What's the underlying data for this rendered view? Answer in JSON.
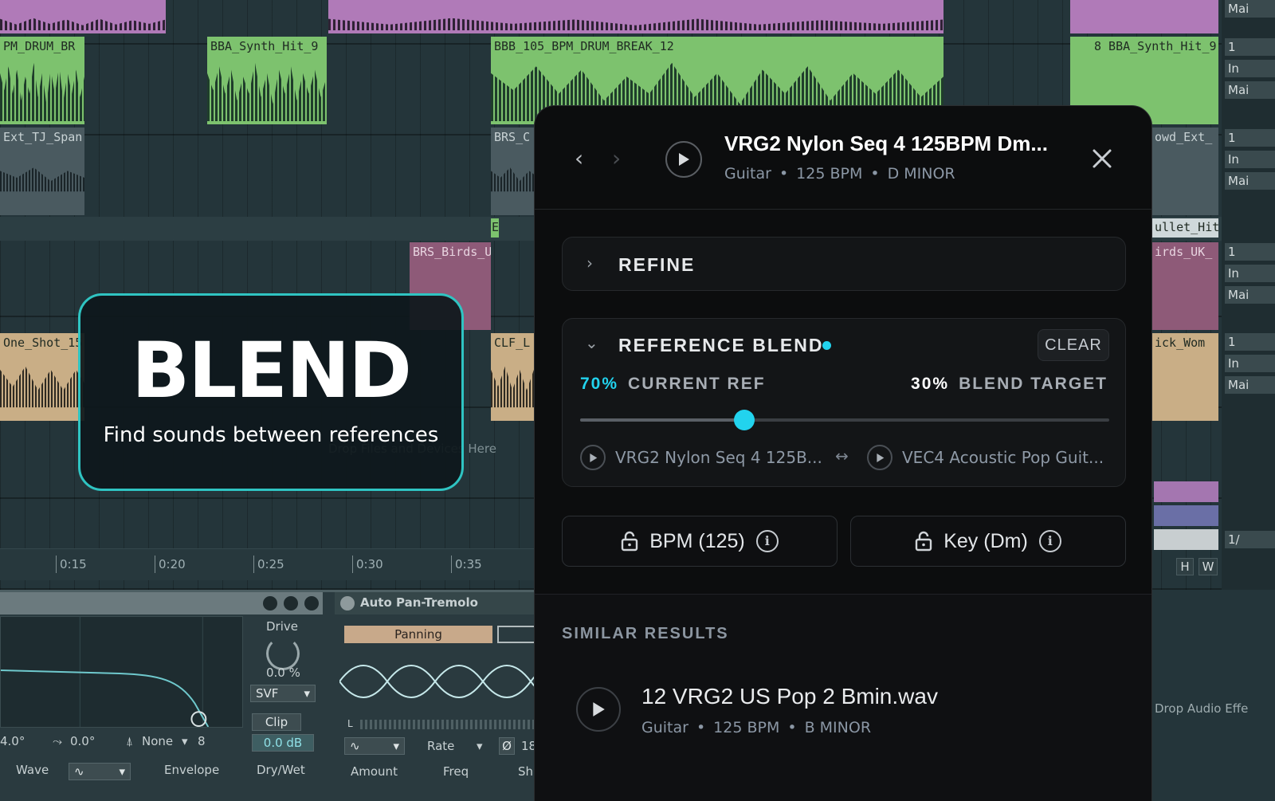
{
  "daw": {
    "clips": {
      "drum_br": "PM_DRUM_BR",
      "synth_hit": "BBA_Synth_Hit_9",
      "drum_break": "BBB_105_BPM_DRUM_BREAK_12",
      "synth_hit_right": "8 BBA_Synth_Hit_9",
      "ext_tj": "Ext_TJ_Span",
      "brs_c": "BRS_C",
      "brs_birds": "BRS_Birds_U",
      "one_shot": "One_Shot_15",
      "clf": "CLF_L",
      "owd_ext": "owd_Ext_",
      "ullet_hit": "ullet_Hit_",
      "irds_uk": "irds_UK_",
      "ick_wom": "ick_Wom",
      "small_e": "E"
    },
    "ruler": [
      "0:15",
      "0:20",
      "0:25",
      "0:30",
      "0:35"
    ],
    "drop_files": "Drop Files and Devices Here",
    "device1": {
      "drive_label": "Drive",
      "drive_value": "0.0 %",
      "filter_type": "SVF",
      "clip_label": "Clip",
      "clip_value": "0.0 dB",
      "readout_a": "4.0°",
      "readout_b": "0.0°",
      "readout_c": "None",
      "readout_d": "8",
      "wave_label": "Wave",
      "envelope_label": "Envelope",
      "drywet_label": "Dry/Wet"
    },
    "device2": {
      "name": "Auto Pan-Tremolo",
      "mode": "Panning",
      "rate_label": "Rate",
      "amount_label": "Amount",
      "freq_label": "Freq",
      "sh_label": "Sh",
      "phase_sym": "Ø",
      "phase_val": "18",
      "meter_l": "L"
    },
    "mixer": {
      "rows": [
        {
          "a": "Mai",
          "b": ""
        },
        {
          "a": "1",
          "b": "In",
          "c": "Mai"
        },
        {
          "a": "1",
          "b": "In",
          "c": "Mai"
        },
        {
          "a": "1",
          "b": "In",
          "c": "Mai"
        },
        {
          "a": "1",
          "b": "In",
          "c": "Mai"
        }
      ],
      "fraction": "1/",
      "h_btn": "H",
      "w_btn": "W"
    },
    "drop_audio": "Drop Audio Effe"
  },
  "blend_card": {
    "title": "BLEND",
    "subtitle": "Find sounds between references"
  },
  "panel": {
    "title": "VRG2 Nylon Seq 4 125BPM Dm...",
    "meta": {
      "instrument": "Guitar",
      "bpm": "125 BPM",
      "key": "D MINOR"
    },
    "refine_label": "REFINE",
    "blend": {
      "label": "REFERENCE BLEND",
      "clear_label": "CLEAR",
      "current_pct": "70%",
      "current_label": "CURRENT REF",
      "target_pct": "30%",
      "target_label": "BLEND TARGET",
      "position": 0.31,
      "ref_a": "VRG2 Nylon Seq 4 125B...",
      "ref_b": "VEC4 Acoustic Pop Guit..."
    },
    "locks": {
      "bpm_label": "BPM (125)",
      "key_label": "Key (Dm)"
    },
    "similar": {
      "title": "SIMILAR RESULTS",
      "result_title": "12 VRG2 US Pop 2 Bmin.wav",
      "result_meta": {
        "instrument": "Guitar",
        "bpm": "125 BPM",
        "key": "B MINOR"
      }
    },
    "colors": {
      "accent": "#22d3ee",
      "blend_border": "#2fc4c2"
    }
  }
}
